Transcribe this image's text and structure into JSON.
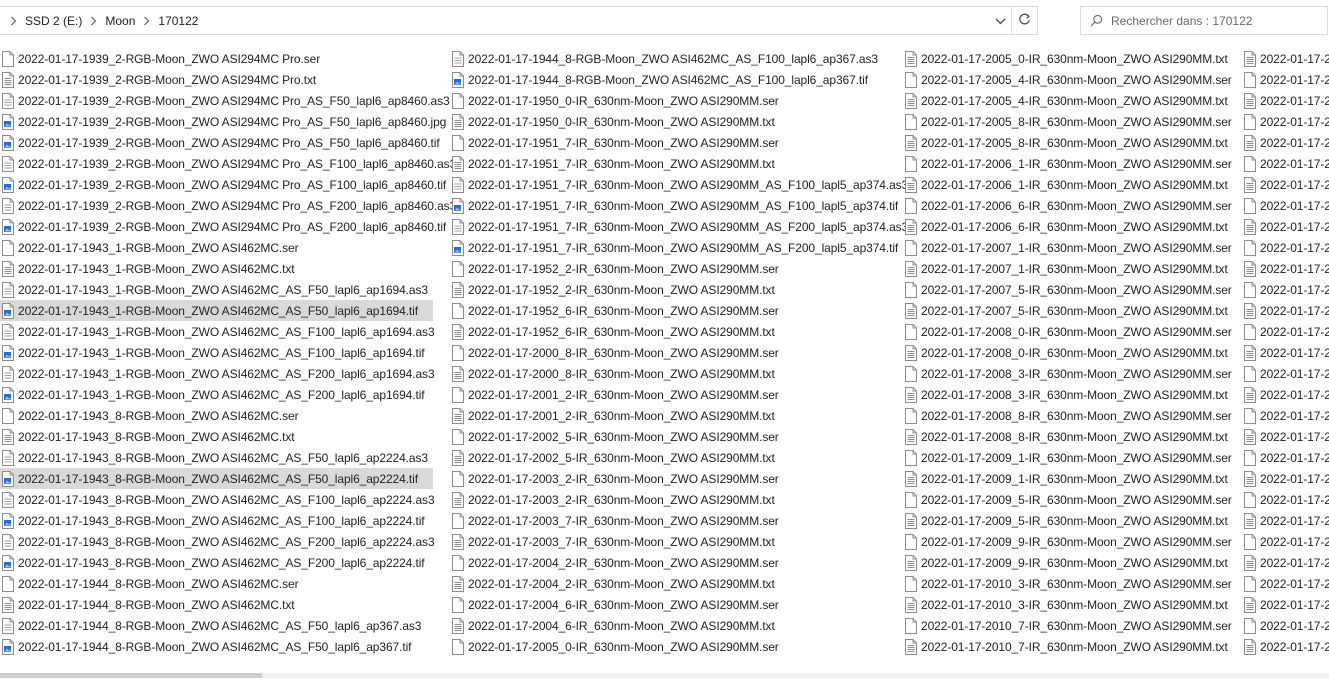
{
  "address": {
    "crumbs": [
      "SSD 2 (E:)",
      "Moon",
      "170122"
    ],
    "icons": {
      "separator": "chevron-right-icon",
      "dropdown": "chevron-down-icon",
      "refresh": "refresh-icon"
    }
  },
  "search": {
    "placeholder": "Rechercher dans : 170122",
    "icon": "search-icon"
  },
  "colors": {
    "selection": "#d9d9d9",
    "tif_icon": "#1e6fd9",
    "border": "#d9d9d9"
  },
  "columns": [
    [
      {
        "name": "2022-01-17-1939_2-RGB-Moon_ZWO ASI294MC Pro.ser",
        "type": "ser"
      },
      {
        "name": "2022-01-17-1939_2-RGB-Moon_ZWO ASI294MC Pro.txt",
        "type": "txt"
      },
      {
        "name": "2022-01-17-1939_2-RGB-Moon_ZWO ASI294MC Pro_AS_F50_lapl6_ap8460.as3",
        "type": "as3"
      },
      {
        "name": "2022-01-17-1939_2-RGB-Moon_ZWO ASI294MC Pro_AS_F50_lapl6_ap8460.jpg",
        "type": "img"
      },
      {
        "name": "2022-01-17-1939_2-RGB-Moon_ZWO ASI294MC Pro_AS_F50_lapl6_ap8460.tif",
        "type": "img"
      },
      {
        "name": "2022-01-17-1939_2-RGB-Moon_ZWO ASI294MC Pro_AS_F100_lapl6_ap8460.as3",
        "type": "as3"
      },
      {
        "name": "2022-01-17-1939_2-RGB-Moon_ZWO ASI294MC Pro_AS_F100_lapl6_ap8460.tif",
        "type": "img"
      },
      {
        "name": "2022-01-17-1939_2-RGB-Moon_ZWO ASI294MC Pro_AS_F200_lapl6_ap8460.as3",
        "type": "as3"
      },
      {
        "name": "2022-01-17-1939_2-RGB-Moon_ZWO ASI294MC Pro_AS_F200_lapl6_ap8460.tif",
        "type": "img"
      },
      {
        "name": "2022-01-17-1943_1-RGB-Moon_ZWO ASI462MC.ser",
        "type": "ser"
      },
      {
        "name": "2022-01-17-1943_1-RGB-Moon_ZWO ASI462MC.txt",
        "type": "txt"
      },
      {
        "name": "2022-01-17-1943_1-RGB-Moon_ZWO ASI462MC_AS_F50_lapl6_ap1694.as3",
        "type": "as3"
      },
      {
        "name": "2022-01-17-1943_1-RGB-Moon_ZWO ASI462MC_AS_F50_lapl6_ap1694.tif",
        "type": "img",
        "selected": true
      },
      {
        "name": "2022-01-17-1943_1-RGB-Moon_ZWO ASI462MC_AS_F100_lapl6_ap1694.as3",
        "type": "as3"
      },
      {
        "name": "2022-01-17-1943_1-RGB-Moon_ZWO ASI462MC_AS_F100_lapl6_ap1694.tif",
        "type": "img"
      },
      {
        "name": "2022-01-17-1943_1-RGB-Moon_ZWO ASI462MC_AS_F200_lapl6_ap1694.as3",
        "type": "as3"
      },
      {
        "name": "2022-01-17-1943_1-RGB-Moon_ZWO ASI462MC_AS_F200_lapl6_ap1694.tif",
        "type": "img"
      },
      {
        "name": "2022-01-17-1943_8-RGB-Moon_ZWO ASI462MC.ser",
        "type": "ser"
      },
      {
        "name": "2022-01-17-1943_8-RGB-Moon_ZWO ASI462MC.txt",
        "type": "txt"
      },
      {
        "name": "2022-01-17-1943_8-RGB-Moon_ZWO ASI462MC_AS_F50_lapl6_ap2224.as3",
        "type": "as3"
      },
      {
        "name": "2022-01-17-1943_8-RGB-Moon_ZWO ASI462MC_AS_F50_lapl6_ap2224.tif",
        "type": "img",
        "selected": true
      },
      {
        "name": "2022-01-17-1943_8-RGB-Moon_ZWO ASI462MC_AS_F100_lapl6_ap2224.as3",
        "type": "as3"
      },
      {
        "name": "2022-01-17-1943_8-RGB-Moon_ZWO ASI462MC_AS_F100_lapl6_ap2224.tif",
        "type": "img"
      },
      {
        "name": "2022-01-17-1943_8-RGB-Moon_ZWO ASI462MC_AS_F200_lapl6_ap2224.as3",
        "type": "as3"
      },
      {
        "name": "2022-01-17-1943_8-RGB-Moon_ZWO ASI462MC_AS_F200_lapl6_ap2224.tif",
        "type": "img"
      },
      {
        "name": "2022-01-17-1944_8-RGB-Moon_ZWO ASI462MC.ser",
        "type": "ser"
      },
      {
        "name": "2022-01-17-1944_8-RGB-Moon_ZWO ASI462MC.txt",
        "type": "txt"
      },
      {
        "name": "2022-01-17-1944_8-RGB-Moon_ZWO ASI462MC_AS_F50_lapl6_ap367.as3",
        "type": "as3"
      },
      {
        "name": "2022-01-17-1944_8-RGB-Moon_ZWO ASI462MC_AS_F50_lapl6_ap367.tif",
        "type": "img"
      }
    ],
    [
      {
        "name": "2022-01-17-1944_8-RGB-Moon_ZWO ASI462MC_AS_F100_lapl6_ap367.as3",
        "type": "as3"
      },
      {
        "name": "2022-01-17-1944_8-RGB-Moon_ZWO ASI462MC_AS_F100_lapl6_ap367.tif",
        "type": "img"
      },
      {
        "name": "2022-01-17-1950_0-IR_630nm-Moon_ZWO ASI290MM.ser",
        "type": "ser"
      },
      {
        "name": "2022-01-17-1950_0-IR_630nm-Moon_ZWO ASI290MM.txt",
        "type": "txt"
      },
      {
        "name": "2022-01-17-1951_7-IR_630nm-Moon_ZWO ASI290MM.ser",
        "type": "ser"
      },
      {
        "name": "2022-01-17-1951_7-IR_630nm-Moon_ZWO ASI290MM.txt",
        "type": "txt"
      },
      {
        "name": "2022-01-17-1951_7-IR_630nm-Moon_ZWO ASI290MM_AS_F100_lapl5_ap374.as3",
        "type": "as3"
      },
      {
        "name": "2022-01-17-1951_7-IR_630nm-Moon_ZWO ASI290MM_AS_F100_lapl5_ap374.tif",
        "type": "img"
      },
      {
        "name": "2022-01-17-1951_7-IR_630nm-Moon_ZWO ASI290MM_AS_F200_lapl5_ap374.as3",
        "type": "as3"
      },
      {
        "name": "2022-01-17-1951_7-IR_630nm-Moon_ZWO ASI290MM_AS_F200_lapl5_ap374.tif",
        "type": "img"
      },
      {
        "name": "2022-01-17-1952_2-IR_630nm-Moon_ZWO ASI290MM.ser",
        "type": "ser"
      },
      {
        "name": "2022-01-17-1952_2-IR_630nm-Moon_ZWO ASI290MM.txt",
        "type": "txt"
      },
      {
        "name": "2022-01-17-1952_6-IR_630nm-Moon_ZWO ASI290MM.ser",
        "type": "ser"
      },
      {
        "name": "2022-01-17-1952_6-IR_630nm-Moon_ZWO ASI290MM.txt",
        "type": "txt"
      },
      {
        "name": "2022-01-17-2000_8-IR_630nm-Moon_ZWO ASI290MM.ser",
        "type": "ser"
      },
      {
        "name": "2022-01-17-2000_8-IR_630nm-Moon_ZWO ASI290MM.txt",
        "type": "txt"
      },
      {
        "name": "2022-01-17-2001_2-IR_630nm-Moon_ZWO ASI290MM.ser",
        "type": "ser"
      },
      {
        "name": "2022-01-17-2001_2-IR_630nm-Moon_ZWO ASI290MM.txt",
        "type": "txt"
      },
      {
        "name": "2022-01-17-2002_5-IR_630nm-Moon_ZWO ASI290MM.ser",
        "type": "ser"
      },
      {
        "name": "2022-01-17-2002_5-IR_630nm-Moon_ZWO ASI290MM.txt",
        "type": "txt"
      },
      {
        "name": "2022-01-17-2003_2-IR_630nm-Moon_ZWO ASI290MM.ser",
        "type": "ser"
      },
      {
        "name": "2022-01-17-2003_2-IR_630nm-Moon_ZWO ASI290MM.txt",
        "type": "txt"
      },
      {
        "name": "2022-01-17-2003_7-IR_630nm-Moon_ZWO ASI290MM.ser",
        "type": "ser"
      },
      {
        "name": "2022-01-17-2003_7-IR_630nm-Moon_ZWO ASI290MM.txt",
        "type": "txt"
      },
      {
        "name": "2022-01-17-2004_2-IR_630nm-Moon_ZWO ASI290MM.ser",
        "type": "ser"
      },
      {
        "name": "2022-01-17-2004_2-IR_630nm-Moon_ZWO ASI290MM.txt",
        "type": "txt"
      },
      {
        "name": "2022-01-17-2004_6-IR_630nm-Moon_ZWO ASI290MM.ser",
        "type": "ser"
      },
      {
        "name": "2022-01-17-2004_6-IR_630nm-Moon_ZWO ASI290MM.txt",
        "type": "txt"
      },
      {
        "name": "2022-01-17-2005_0-IR_630nm-Moon_ZWO ASI290MM.ser",
        "type": "ser"
      }
    ],
    [
      {
        "name": "2022-01-17-2005_0-IR_630nm-Moon_ZWO ASI290MM.txt",
        "type": "txt"
      },
      {
        "name": "2022-01-17-2005_4-IR_630nm-Moon_ZWO ASI290MM.ser",
        "type": "ser"
      },
      {
        "name": "2022-01-17-2005_4-IR_630nm-Moon_ZWO ASI290MM.txt",
        "type": "txt"
      },
      {
        "name": "2022-01-17-2005_8-IR_630nm-Moon_ZWO ASI290MM.ser",
        "type": "ser"
      },
      {
        "name": "2022-01-17-2005_8-IR_630nm-Moon_ZWO ASI290MM.txt",
        "type": "txt"
      },
      {
        "name": "2022-01-17-2006_1-IR_630nm-Moon_ZWO ASI290MM.ser",
        "type": "ser"
      },
      {
        "name": "2022-01-17-2006_1-IR_630nm-Moon_ZWO ASI290MM.txt",
        "type": "txt"
      },
      {
        "name": "2022-01-17-2006_6-IR_630nm-Moon_ZWO ASI290MM.ser",
        "type": "ser"
      },
      {
        "name": "2022-01-17-2006_6-IR_630nm-Moon_ZWO ASI290MM.txt",
        "type": "txt"
      },
      {
        "name": "2022-01-17-2007_1-IR_630nm-Moon_ZWO ASI290MM.ser",
        "type": "ser"
      },
      {
        "name": "2022-01-17-2007_1-IR_630nm-Moon_ZWO ASI290MM.txt",
        "type": "txt"
      },
      {
        "name": "2022-01-17-2007_5-IR_630nm-Moon_ZWO ASI290MM.ser",
        "type": "ser"
      },
      {
        "name": "2022-01-17-2007_5-IR_630nm-Moon_ZWO ASI290MM.txt",
        "type": "txt"
      },
      {
        "name": "2022-01-17-2008_0-IR_630nm-Moon_ZWO ASI290MM.ser",
        "type": "ser"
      },
      {
        "name": "2022-01-17-2008_0-IR_630nm-Moon_ZWO ASI290MM.txt",
        "type": "txt"
      },
      {
        "name": "2022-01-17-2008_3-IR_630nm-Moon_ZWO ASI290MM.ser",
        "type": "ser"
      },
      {
        "name": "2022-01-17-2008_3-IR_630nm-Moon_ZWO ASI290MM.txt",
        "type": "txt"
      },
      {
        "name": "2022-01-17-2008_8-IR_630nm-Moon_ZWO ASI290MM.ser",
        "type": "ser"
      },
      {
        "name": "2022-01-17-2008_8-IR_630nm-Moon_ZWO ASI290MM.txt",
        "type": "txt"
      },
      {
        "name": "2022-01-17-2009_1-IR_630nm-Moon_ZWO ASI290MM.ser",
        "type": "ser"
      },
      {
        "name": "2022-01-17-2009_1-IR_630nm-Moon_ZWO ASI290MM.txt",
        "type": "txt"
      },
      {
        "name": "2022-01-17-2009_5-IR_630nm-Moon_ZWO ASI290MM.ser",
        "type": "ser"
      },
      {
        "name": "2022-01-17-2009_5-IR_630nm-Moon_ZWO ASI290MM.txt",
        "type": "txt"
      },
      {
        "name": "2022-01-17-2009_9-IR_630nm-Moon_ZWO ASI290MM.ser",
        "type": "ser"
      },
      {
        "name": "2022-01-17-2009_9-IR_630nm-Moon_ZWO ASI290MM.txt",
        "type": "txt"
      },
      {
        "name": "2022-01-17-2010_3-IR_630nm-Moon_ZWO ASI290MM.ser",
        "type": "ser"
      },
      {
        "name": "2022-01-17-2010_3-IR_630nm-Moon_ZWO ASI290MM.txt",
        "type": "txt"
      },
      {
        "name": "2022-01-17-2010_7-IR_630nm-Moon_ZWO ASI290MM.ser",
        "type": "ser"
      },
      {
        "name": "2022-01-17-2010_7-IR_630nm-Moon_ZWO ASI290MM.txt",
        "type": "txt"
      }
    ],
    [
      {
        "name": "2022-01-17-2",
        "type": "txt"
      },
      {
        "name": "2022-01-17-2",
        "type": "ser"
      },
      {
        "name": "2022-01-17-2",
        "type": "txt"
      },
      {
        "name": "2022-01-17-2",
        "type": "ser"
      },
      {
        "name": "2022-01-17-2",
        "type": "txt"
      },
      {
        "name": "2022-01-17-2",
        "type": "ser"
      },
      {
        "name": "2022-01-17-2",
        "type": "txt"
      },
      {
        "name": "2022-01-17-2",
        "type": "ser"
      },
      {
        "name": "2022-01-17-2",
        "type": "txt"
      },
      {
        "name": "2022-01-17-2",
        "type": "ser"
      },
      {
        "name": "2022-01-17-2",
        "type": "txt"
      },
      {
        "name": "2022-01-17-2",
        "type": "ser"
      },
      {
        "name": "2022-01-17-2",
        "type": "txt"
      },
      {
        "name": "2022-01-17-2",
        "type": "ser"
      },
      {
        "name": "2022-01-17-2",
        "type": "txt"
      },
      {
        "name": "2022-01-17-2",
        "type": "ser"
      },
      {
        "name": "2022-01-17-2",
        "type": "txt"
      },
      {
        "name": "2022-01-17-2",
        "type": "ser"
      },
      {
        "name": "2022-01-17-2",
        "type": "txt"
      },
      {
        "name": "2022-01-17-2",
        "type": "ser"
      },
      {
        "name": "2022-01-17-2",
        "type": "txt"
      },
      {
        "name": "2022-01-17-2",
        "type": "ser"
      },
      {
        "name": "2022-01-17-2",
        "type": "txt"
      },
      {
        "name": "2022-01-17-2",
        "type": "ser"
      },
      {
        "name": "2022-01-17-2",
        "type": "txt"
      },
      {
        "name": "2022-01-17-2",
        "type": "ser"
      },
      {
        "name": "2022-01-17-2",
        "type": "txt"
      },
      {
        "name": "2022-01-17-2",
        "type": "ser"
      },
      {
        "name": "2022-01-17-2",
        "type": "txt"
      }
    ]
  ]
}
